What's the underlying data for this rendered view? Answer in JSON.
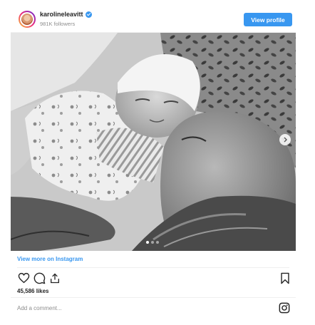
{
  "header": {
    "username": "karolineleavitt",
    "followers": "981K followers",
    "view_profile_label": "View profile",
    "verified": true
  },
  "photo": {
    "description_icon": "photo",
    "carousel_total": 3,
    "carousel_active": 1
  },
  "footer": {
    "view_more_label": "View more on Instagram",
    "likes": "45,586 likes",
    "comment_placeholder": "Add a comment..."
  },
  "icons": {
    "like": "heart-icon",
    "comment": "comment-icon",
    "share": "share-icon",
    "save": "bookmark-icon",
    "instagram": "instagram-icon",
    "next": "chevron-right-icon"
  },
  "colors": {
    "accent": "#3897f0",
    "text": "#262626",
    "muted": "#8e8e8e"
  }
}
